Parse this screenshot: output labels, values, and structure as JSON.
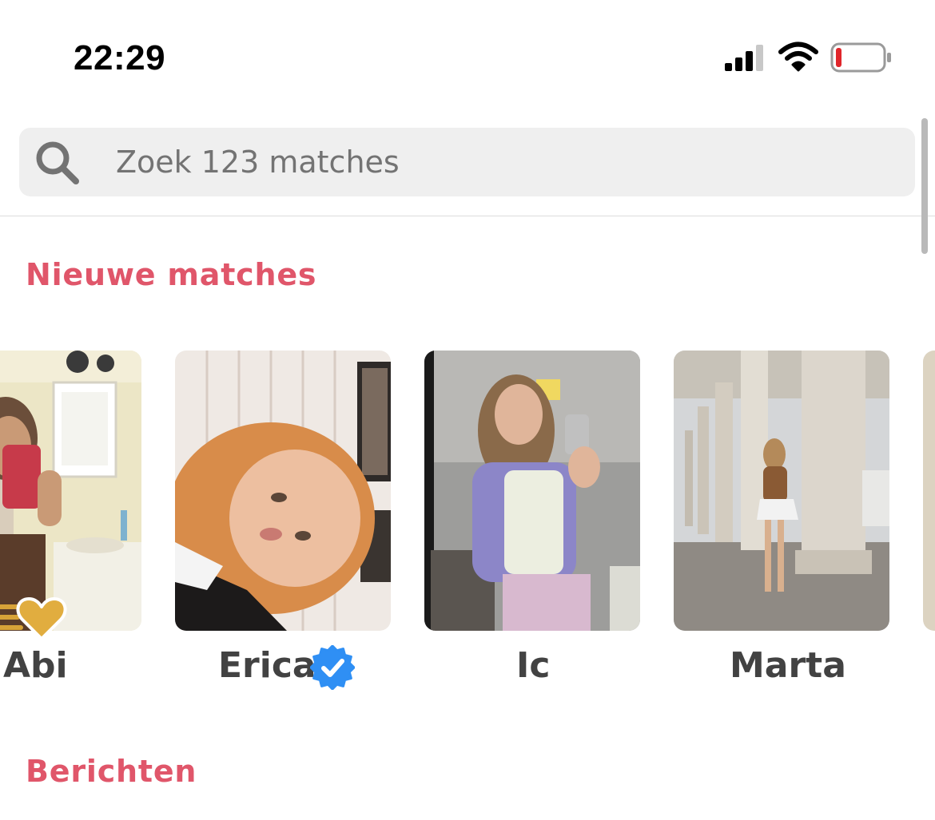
{
  "status_bar": {
    "time": "22:29",
    "icons": [
      "signal-icon",
      "wifi-icon",
      "battery-low-icon"
    ],
    "battery_level": 0.12
  },
  "search": {
    "placeholder": "Zoek 123 matches",
    "value": "",
    "icon": "search-icon"
  },
  "sections": {
    "new_matches": "Nieuwe matches",
    "messages": "Berichten"
  },
  "matches": [
    {
      "name": "Abi",
      "badge": "super-like-heart-icon"
    },
    {
      "name": "Erica",
      "badge": "verified-check-icon"
    },
    {
      "name": "Ic"
    },
    {
      "name": "Marta"
    }
  ],
  "colors": {
    "accent": "#e0566a",
    "badge_blue": "#2f8ff4",
    "gold": "#d8a338",
    "name_text": "#424242"
  }
}
